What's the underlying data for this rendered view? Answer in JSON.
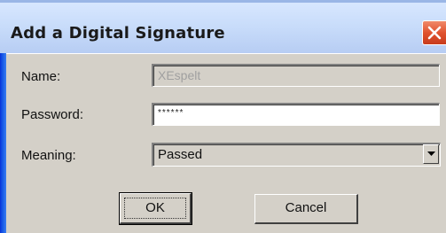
{
  "window": {
    "title": "Add a Digital Signature"
  },
  "form": {
    "name_label": "Name:",
    "name_value": "XEspelt",
    "password_label": "Password:",
    "password_value": "******",
    "meaning_label": "Meaning:",
    "meaning_value": "Passed"
  },
  "buttons": {
    "ok_label": "OK",
    "cancel_label": "Cancel"
  },
  "icons": {
    "close": "close-icon",
    "dropdown": "chevron-down-icon"
  },
  "colors": {
    "titlebar": "#c8dcfa",
    "close_button": "#e0532f",
    "dialog_bg": "#d4d0c8",
    "frame": "#1658e6"
  }
}
